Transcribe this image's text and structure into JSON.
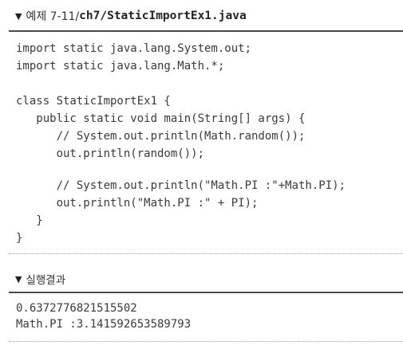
{
  "header": {
    "prefix": "예제 7-11/",
    "path": "ch7/StaticImportEx1.java"
  },
  "code_lines": [
    "import static java.lang.System.out;",
    "import static java.lang.Math.*;",
    "class StaticImportEx1 {",
    "   public static void main(String[] args) {",
    "      // System.out.println(Math.random());",
    "      out.println(random());",
    "      // System.out.println(\"Math.PI :\"+Math.PI);",
    "      out.println(\"Math.PI :\" + PI);",
    "   }",
    "}"
  ],
  "result": {
    "title": "실행결과",
    "lines": [
      "0.6372776821515502",
      "Math.PI :3.141592653589793"
    ]
  },
  "icons": {
    "section_marker": "down-triangle-icon"
  }
}
